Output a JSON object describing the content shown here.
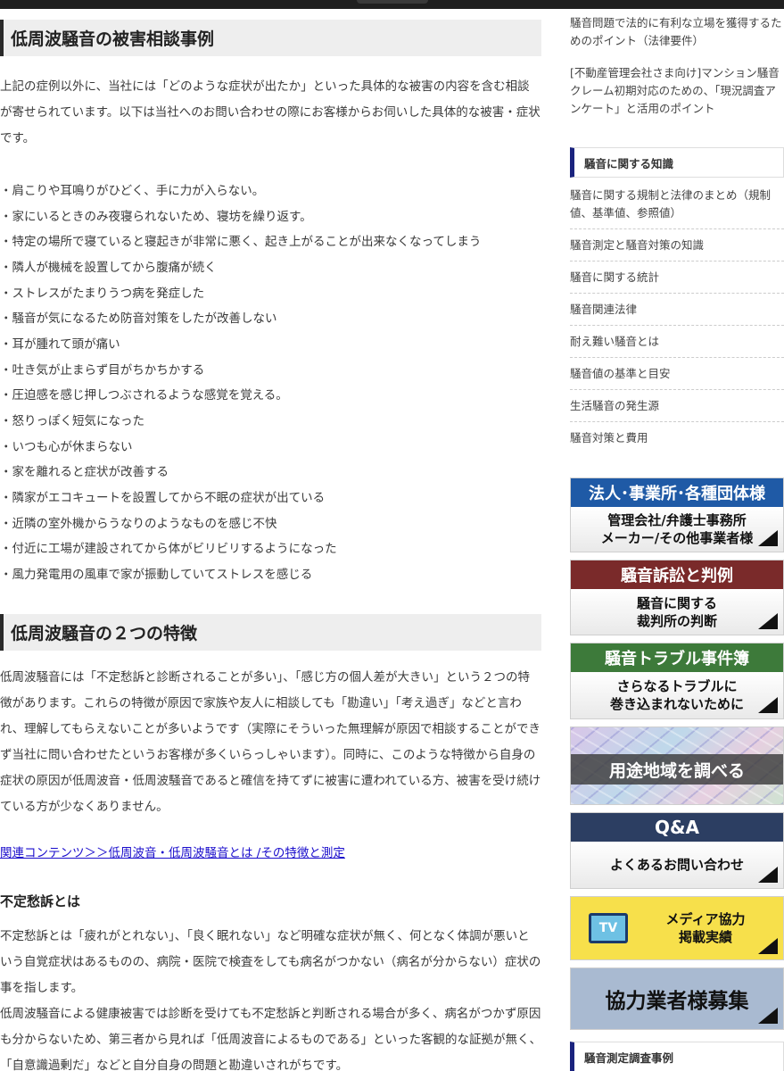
{
  "article": {
    "heading1": "低周波騒音の被害相談事例",
    "intro": "上記の症例以外に、当社には「どのような症状が出たか」といった具体的な被害の内容を含む相談が寄せられています。以下は当社へのお問い合わせの際にお客様からお伺いした具体的な被害・症状です。",
    "symptoms": [
      "・肩こりや耳鳴りがひどく、手に力が入らない。",
      "・家にいるときのみ夜寝られないため、寝坊を繰り返す。",
      "・特定の場所で寝ていると寝起きが非常に悪く、起き上がることが出来なくなってしまう",
      "・隣人が機械を設置してから腹痛が続く",
      "・ストレスがたまりうつ病を発症した",
      "・騒音が気になるため防音対策をしたが改善しない",
      "・耳が腫れて頭が痛い",
      "・吐き気が止まらず目がちかちかする",
      "・圧迫感を感じ押しつぶされるような感覚を覚える。",
      "・怒りっぽく短気になった",
      "・いつも心が休まらない",
      "・家を離れると症状が改善する",
      "・隣家がエコキュートを設置してから不眠の症状が出ている",
      "・近隣の室外機からうなりのようなものを感じ不快",
      "・付近に工場が建設されてから体がビリビリするようになった",
      "・風力発電用の風車で家が振動していてストレスを感じる"
    ],
    "heading2": "低周波騒音の２つの特徴",
    "features": "低周波騒音には「不定愁訴と診断されることが多い」、「感じ方の個人差が大きい」という２つの特徴があります。これらの特徴が原因で家族や友人に相談しても「勘違い」「考え過ぎ」などと言われ、理解してもらえないことが多いようです（実際にそういった無理解が原因で相談することができず当社に問い合わせたというお客様が多くいらっしゃいます）。同時に、このような特徴から自身の症状の原因が低周波音・低周波騒音であると確信を持てずに被害に遭われている方、被害を受け続けている方が少なくありません。",
    "related_link": "関連コンテンツ＞＞低周波音・低周波騒音とは /その特徴と測定",
    "subheading": "不定愁訴とは",
    "fuatei_p1": "不定愁訴とは「疲れがとれない」、「良く眠れない」など明確な症状が無く、何となく体調が悪いという自覚症状はあるものの、病院・医院で検査をしても病名がつかない（病名が分からない）症状の事を指します。",
    "fuatei_p2": "低周波騒音による健康被害では診断を受けても不定愁訴と判断される場合が多く、病名がつかず原因も分からないため、第三者から見れば「低周波音によるものである」といった客観的な証拠が無く、「自意識過剰だ」などと自分自身の問題と勘違いされがちです。"
  },
  "sidebar": {
    "top_links": [
      "騒音問題で法的に有利な立場を獲得するためのポイント（法律要件）",
      "[不動産管理会社さま向け]マンション騒音クレーム初期対応のための、「現況調査アンケート」と活用のポイント"
    ],
    "knowledge_title": "騒音に関する知識",
    "knowledge_items": [
      "騒音に関する規制と法律のまとめ（規制値、基準値、参照値）",
      "騒音測定と騒音対策の知識",
      "騒音に関する統計",
      "騒音関連法律",
      "耐え難い騒音とは",
      "騒音値の基準と目安",
      "生活騒音の発生源",
      "騒音対策と費用"
    ],
    "banners": {
      "b1_band": "法人･事業所･各種団体様",
      "b1_line1": "管理会社/弁護士事務所",
      "b1_line2": "メーカー/その他事業者様",
      "b2_band": "騒音訴訟と判例",
      "b2_line1": "騒音に関する",
      "b2_line2": "裁判所の判断",
      "b3_band": "騒音トラブル事件簿",
      "b3_line1": "さらなるトラブルに",
      "b3_line2": "巻き込まれないために",
      "b4_text": "用途地域を調べる",
      "b5_band": "Q&A",
      "b5_line1": "よくあるお問い合わせ",
      "b6_icon": "TV",
      "b6_line1": "メディア協力",
      "b6_line2": "掲載実績",
      "b7_text": "協力業者様募集"
    },
    "cases_title": "騒音測定調査事例"
  }
}
